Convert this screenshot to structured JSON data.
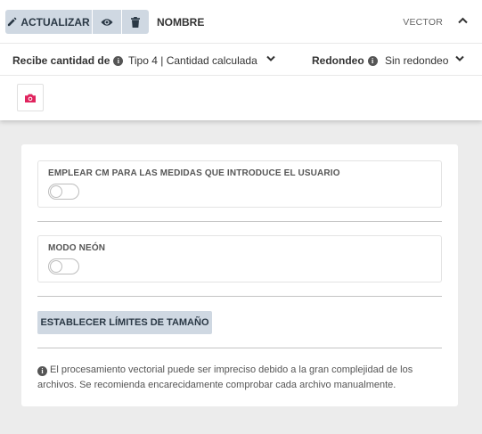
{
  "toolbar": {
    "update_label": "ACTUALIZAR",
    "name_label": "NOMBRE",
    "type_label": "VECTOR"
  },
  "settings": {
    "quantity_label": "Recibe cantidad de",
    "quantity_value": "Tipo 4 | Cantidad calculada",
    "rounding_label": "Redondeo",
    "rounding_value": "Sin redondeo"
  },
  "options": {
    "cm_title": "EMPLEAR CM PARA LAS MEDIDAS QUE INTRODUCE EL USUARIO",
    "cm_enabled": false,
    "neon_title": "MODO NEÓN",
    "neon_enabled": false
  },
  "limits_button": "ESTABLECER LÍMITES DE TAMAÑO",
  "note": "El procesamiento vectorial puede ser impreciso debido a la gran complejidad de los archivos. Se recomienda encarecidamente comprobar cada archivo manualmente.",
  "icons": {
    "update": "pencil-icon",
    "view": "eye-icon",
    "delete": "trash-icon",
    "collapse": "chevron-up-icon",
    "info": "info-icon",
    "dropdown": "chevron-down-icon",
    "camera": "camera-icon"
  },
  "colors": {
    "button_bg": "#cfd8e2",
    "button_text": "#2a3845",
    "camera_accent": "#e0245e",
    "page_bg": "#ececec"
  }
}
